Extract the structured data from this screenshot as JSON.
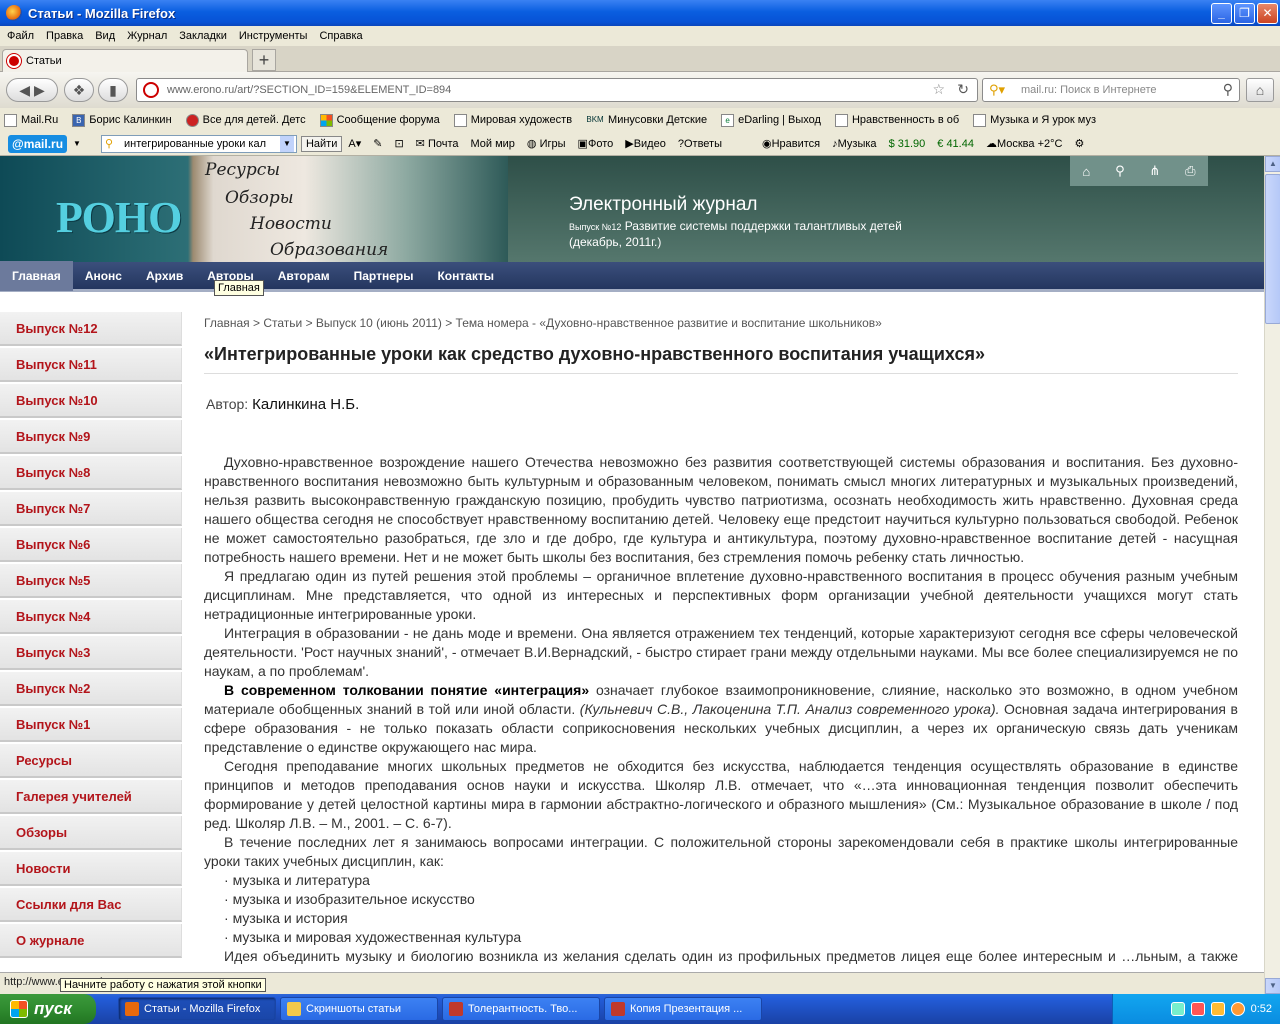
{
  "window": {
    "title": "Статьи - Mozilla Firefox",
    "min": "_",
    "max": "❐",
    "close": "✕"
  },
  "menu": [
    "Файл",
    "Правка",
    "Вид",
    "Журнал",
    "Закладки",
    "Инструменты",
    "Справка"
  ],
  "tabs": [
    {
      "label": "Статьи"
    }
  ],
  "newtab": "+",
  "address": {
    "url": "www.erono.ru/art/?SECTION_ID=159&ELEMENT_ID=894"
  },
  "search": {
    "placeholder": "mail.ru: Поиск в Интернете"
  },
  "bookmarks": [
    "Mail.Ru",
    "Борис Калинкин",
    "Все для детей. Детс",
    "Сообщение форума",
    "Мировая художеств",
    "Минусовки Детские",
    "eDarling | Выход",
    "Нравственность в об",
    "Музыка и Я урок муз"
  ],
  "mailbar": {
    "brand": "@mail.ru",
    "query": "интегрированные уроки кал",
    "find": "Найти",
    "items": [
      "Почта",
      "Мой мир",
      "Игры",
      "Фото",
      "Видео",
      "Ответы",
      "Нравится",
      "Музыка",
      "$ 31.90",
      "€ 41.44",
      "Москва +2°C"
    ]
  },
  "site": {
    "logo": "РОНО",
    "tagline": [
      "Ресурсы",
      "Обзоры",
      "Новости",
      "Образования"
    ],
    "journal_title": "Электронный журнал",
    "issue_small": "Выпуск №12",
    "issue_text": "Развитие системы поддержки талантливых детей (декабрь, 2011г.)",
    "nav": [
      "Главная",
      "Анонс",
      "Архив",
      "Авторы",
      "Авторам",
      "Партнеры",
      "Контакты"
    ],
    "nav_tooltip": "Главная"
  },
  "sidebar": [
    "Выпуск №12",
    "Выпуск №11",
    "Выпуск №10",
    "Выпуск №9",
    "Выпуск №8",
    "Выпуск №7",
    "Выпуск №6",
    "Выпуск №5",
    "Выпуск №4",
    "Выпуск №3",
    "Выпуск №2",
    "Выпуск №1",
    "Ресурсы",
    "Галерея учителей",
    "Обзоры",
    "Новости",
    "Ссылки для Вас",
    "О журнале"
  ],
  "article": {
    "breadcrumb": "Главная > Статьи > Выпуск 10 (июнь 2011) > Тема номера - «Духовно-нравственное развитие и воспитание школьников»",
    "title": "«Интегрированные уроки как средство духовно-нравственного воспитания учащихся»",
    "author_label": "Автор:",
    "author": "Калинкина Н.Б.",
    "p1": "Духовно-нравственное возрождение нашего Отечества невозможно без развития соответствующей системы образования и воспитания. Без духовно-нравственного воспитания невозможно быть культурным и образованным человеком, понимать смысл многих литературных и музыкальных произведений, нельзя развить высоконравственную гражданскую позицию, пробудить чувство патриотизма, осознать необходимость жить нравственно. Духовная среда нашего общества сегодня не способствует нравственному воспитанию детей. Человеку еще предстоит научиться культурно пользоваться свободой. Ребенок не может самостоятельно разобраться, где зло и где добро, где культура и антикультура, поэтому духовно-нравственное воспитание детей - насущная потребность нашего времени. Нет и не может быть школы без воспитания, без стремления помочь ребенку стать личностью.",
    "p2": "Я предлагаю один из путей решения этой проблемы – органичное вплетение духовно-нравственного воспитания в процесс обучения разным учебным дисциплинам. Мне представляется, что одной из интересных и перспективных форм организации учебной деятельности учащихся могут стать нетрадиционные интегрированные уроки.",
    "p3": "Интеграция в образовании - не дань моде и времени. Она является отражением тех тенденций, которые характеризуют сегодня все сферы человеческой деятельности. 'Рост научных знаний', - отмечает В.И.Вернадский, - быстро стирает грани между отдельными науками. Мы все более специализируемся не по наукам, а по проблемам'.",
    "p4_strong": "В современном толковании понятие «интеграция»",
    "p4_rest": " означает глубокое взаимопроникновение, слияние, насколько это возможно, в одном учебном материале обобщенных знаний в той или иной области. ",
    "p4_em": "(Кульневич С.В., Лакоценина Т.П. Анализ современного урока).",
    "p4_tail": " Основная задача интегрирования в сфере образования - не только показать области соприкосновения нескольких учебных дисциплин, а через их органическую связь дать ученикам представление о единстве окружающего нас мира.",
    "p5": "Сегодня преподавание многих школьных предметов не обходится без искусства, наблюдается тенденция осуществлять образование в единстве принципов и методов преподавания основ науки и искусства. Школяр Л.В. отмечает, что «…эта инновационная тенденция позволит обеспечить формирование у детей целостной картины мира в гармонии абстрактно-логического и образного мышления» (См.: Музыкальное образование в школе / под ред. Школяр Л.В. – М., 2001. – С. 6-7).",
    "p6": "В течение последних лет я занимаюсь вопросами интеграции. С положительной стороны зарекомендовали себя в практике школы интегрированные уроки таких учебных дисциплин, как:",
    "list": [
      "музыка и литература",
      "музыка и изобразительное искусство",
      "музыка и история",
      "музыка и мировая художественная культура"
    ],
    "p7": "Идея объединить музыку и биологию возникла из желания сделать один из профильных предметов лицея еще более интересным и …льным, а также раскрыть учащимся новые грани музыки как искусства и как школьного предмета."
  },
  "status": {
    "text": "http://www.erono.ru/",
    "tip": "Начните работу с нажатия этой кнопки"
  },
  "taskbar": {
    "start": "пуск",
    "tasks": [
      "Статьи - Mozilla Firefox",
      "Скриншоты статьи",
      "Толерантность. Тво...",
      "Копия Презентация ..."
    ],
    "clock": "0:52"
  }
}
